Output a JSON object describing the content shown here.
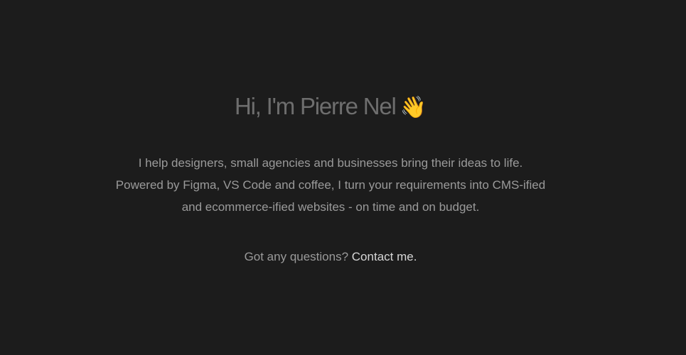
{
  "hero": {
    "title": "Hi, I'm Pierre Nel",
    "wave_icon": "waving-hand-icon",
    "wave_glyph": "👋",
    "intro_lines": [
      "I help designers, small agencies and businesses bring their ideas to life.",
      "Powered by Figma, VS Code and coffee, I turn your requirements into CMS-ified",
      "and ecommerce-ified websites - on time and on budget."
    ],
    "contact_prefix": "Got any questions?",
    "contact_link": "Contact me."
  },
  "colors": {
    "background": "#1c1c1c",
    "title": "#6e6e6e",
    "body_text": "#9a9a9a",
    "link": "#d6d6d6"
  }
}
